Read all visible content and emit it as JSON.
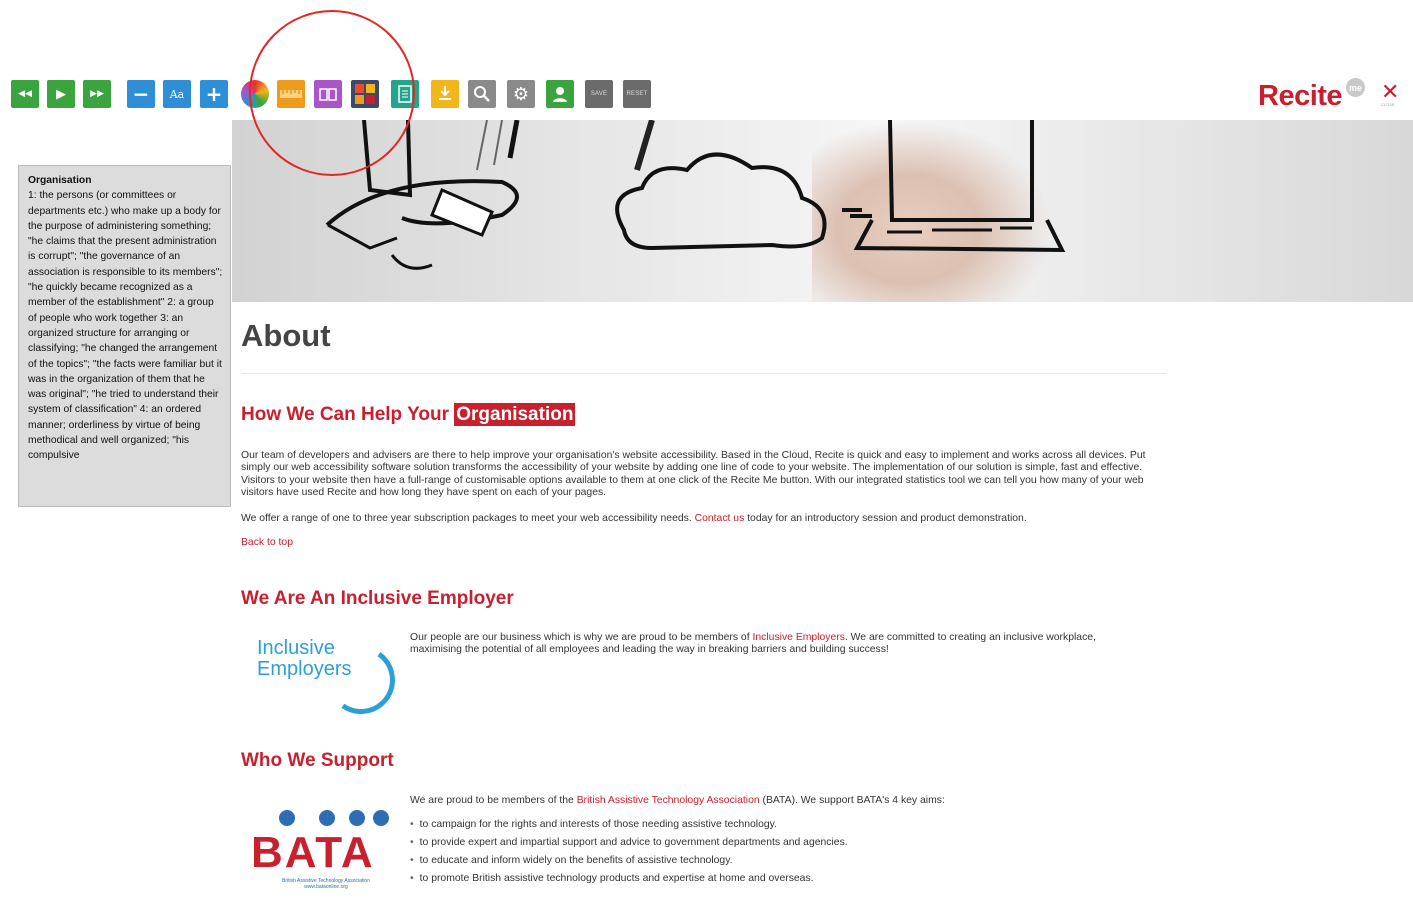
{
  "toolbar": {
    "buttons": [
      {
        "name": "rewind-button",
        "icon": "rewind-icon",
        "glyph": "◀◀",
        "color": "#3aa53e"
      },
      {
        "name": "play-button",
        "icon": "play-icon",
        "glyph": "▶",
        "color": "#3aa53e"
      },
      {
        "name": "fast-forward-button",
        "icon": "fast-forward-icon",
        "glyph": "▶▶",
        "color": "#3aa53e"
      },
      {
        "name": "decrease-text-button",
        "icon": "minus-icon",
        "glyph": "−",
        "color": "#2e8ed6"
      },
      {
        "name": "font-button",
        "icon": "font-icon",
        "glyph": "Aa",
        "color": "#2e8ed6"
      },
      {
        "name": "increase-text-button",
        "icon": "plus-icon",
        "glyph": "+",
        "color": "#2e8ed6"
      },
      {
        "name": "color-button",
        "icon": "color-wheel-icon",
        "glyph": "",
        "color": "#f09a1d"
      },
      {
        "name": "ruler-button",
        "icon": "ruler-icon",
        "glyph": "",
        "color": "#f09a1d"
      },
      {
        "name": "dictionary-button",
        "icon": "dictionary-icon",
        "glyph": "",
        "color": "#a855c8"
      },
      {
        "name": "translate-button",
        "icon": "translate-icon",
        "glyph": "",
        "color": "#e84c2e"
      },
      {
        "name": "text-only-button",
        "icon": "document-icon",
        "glyph": "",
        "color": "#23a58c"
      },
      {
        "name": "download-button",
        "icon": "download-icon",
        "glyph": "",
        "color": "#f2b51a"
      },
      {
        "name": "magnifier-button",
        "icon": "search-icon",
        "glyph": "",
        "color": "#8a8a8a"
      },
      {
        "name": "settings-button",
        "icon": "gear-icon",
        "glyph": "",
        "color": "#8a8a8a"
      },
      {
        "name": "user-button",
        "icon": "user-icon",
        "glyph": "",
        "color": "#3aa53e"
      }
    ],
    "save_label": "SAVE",
    "reset_label": "RESET",
    "logo": "Recite",
    "logo_badge": "me",
    "close_label": "CLOSE",
    "accent": "#c8202e"
  },
  "definition": {
    "title": "Organisation",
    "text": "1: the persons (or committees or departments etc.) who make up a body for the purpose of administering something; \"he claims that the present administration is corrupt\"; \"the governance of an association is responsible to its members\"; \"he quickly became recognized as a member of the establishment\" 2: a group of people who work together 3: an organized structure for arranging or classifying; \"he changed the arrangement of the topics\"; \"the facts were familiar but it was in the organization of them that he was original\"; \"he tried to understand their system of classification\" 4: an ordered manner; orderliness by virtue of being methodical and well organized; \"his compulsive"
  },
  "page": {
    "title": "About",
    "section1": {
      "heading_prefix": "How We Can Help Your ",
      "heading_highlight": "Organisation",
      "para1": "Our team of developers and advisers are there to help improve your organisation's website accessibility. Based in the Cloud, Recite is quick and easy to implement and works across all devices. Put simply our web accessibility software solution transforms the accessibility of your website by adding one line of code to your website. The implementation of our solution is simple, fast and effective. Visitors to your website then have a full-range of customisable options available to them at one click of the Recite Me button. With our integrated statistics tool we can tell you how many of your web visitors have used Recite and how long they have spent on each of your pages.",
      "para2_before": "We offer a range of one to three year subscription packages to meet your web accessibility needs. ",
      "para2_link": "Contact us",
      "para2_after": " today for an introductory session and product demonstration.",
      "back_to_top": "Back to top"
    },
    "section2": {
      "heading": "We Are An Inclusive Employer",
      "logo_line1": "Inclusive",
      "logo_line2": "Employers",
      "para_before": "Our people are our business which is why we are proud to be members of ",
      "para_link": "Inclusive Employers",
      "para_after": ". We are committed to creating an inclusive workplace, maximising the potential of all employees and leading the way in breaking barriers and building success!"
    },
    "section3": {
      "heading": "Who We Support",
      "logo_word": "BATA",
      "logo_sub1": "British Assistive Technology Association",
      "logo_sub2": "www.bataonline.org",
      "para_before": "We are proud to be members of the ",
      "para_link": "British Assistive Technology Association",
      "para_after": " (BATA). We support BATA's 4 key aims:",
      "aims": [
        "to campaign for the rights and interests of those needing assistive technology.",
        "to provide expert and impartial support and advice to government departments and agencies.",
        "to educate and inform widely on the benefits of assistive technology.",
        "to promote British assistive technology products and expertise at home and overseas."
      ]
    }
  }
}
